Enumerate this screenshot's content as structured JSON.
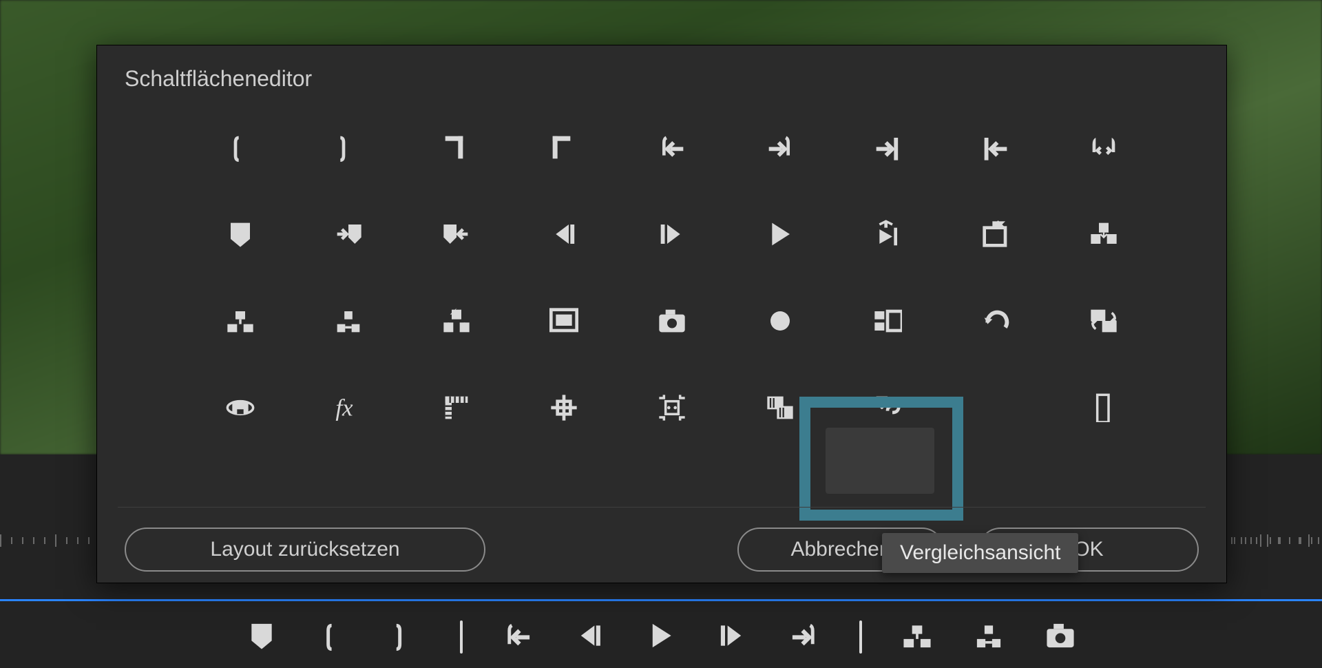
{
  "dialog": {
    "title": "Schaltflächeneditor",
    "reset_label": "Layout zurücksetzen",
    "cancel_label": "Abbrechen",
    "ok_label": "OK",
    "tooltip": "Vergleichsansicht"
  },
  "grid_icons": [
    [
      "mark-in",
      "mark-out",
      "go-to-in",
      "go-to-out",
      "step-back-to-in",
      "step-fwd-to-out",
      "go-to-next-edit",
      "go-to-prev-edit",
      "in-out-around"
    ],
    [
      "add-marker",
      "next-marker",
      "prev-marker",
      "step-back",
      "step-fwd",
      "play",
      "play-in-out",
      "export-frame",
      "insert-overwrite"
    ],
    [
      "lift",
      "extract",
      "overwrite",
      "safe-margins",
      "snapshot",
      "record",
      "multicam",
      "undo",
      "swap"
    ],
    [
      "vr-video",
      "fx",
      "rulers",
      "grid",
      "proxy",
      "comparison-view",
      "link",
      "blank",
      "button-bar"
    ]
  ],
  "transport_icons": [
    "add-marker",
    "mark-in",
    "mark-out",
    "sep",
    "step-back-to-in",
    "step-back",
    "play",
    "step-fwd",
    "step-fwd-to-out",
    "sep",
    "lift",
    "extract",
    "snapshot"
  ]
}
